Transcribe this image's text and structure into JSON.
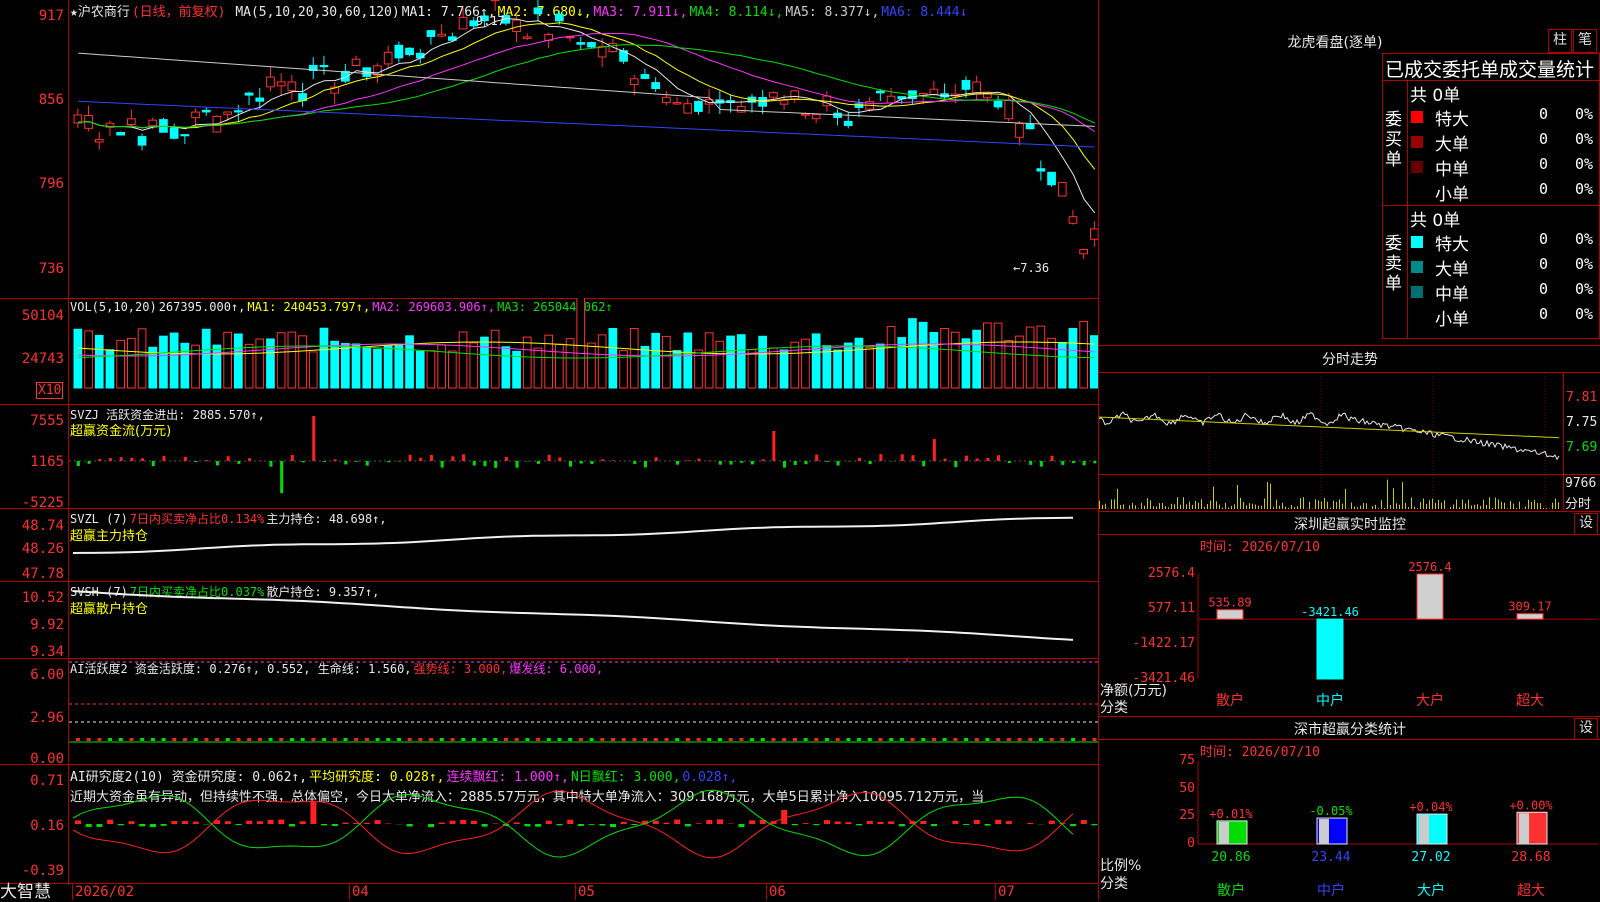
{
  "stock": {
    "title": "★沪农商行",
    "mode": "(日线，前复权)"
  },
  "main": {
    "ma_header": [
      {
        "t": "MA(5,10,20,30,60,120)",
        "c": "#e8e8e8"
      },
      {
        "t": "MA1: 7.766↑,",
        "c": "#e8e8e8"
      },
      {
        "t": "MA2: 7.680↓,",
        "c": "#ffff00"
      },
      {
        "t": "MA3: 7.911↓,",
        "c": "#ff33ff"
      },
      {
        "t": "MA4: 8.114↓,",
        "c": "#00e000"
      },
      {
        "t": "MA5: 8.377↓,",
        "c": "#cccccc"
      },
      {
        "t": "MA6: 8.444↓",
        "c": "#3344ff"
      }
    ],
    "yticks": [
      "917",
      "856",
      "796",
      "736"
    ],
    "high_label": "9.17",
    "low_label": "←7.36"
  },
  "vol": {
    "header": [
      {
        "t": "VOL(5,10,20)",
        "c": "#e8e8e8"
      },
      {
        "t": "267395.000↑,",
        "c": "#e8e8e8"
      },
      {
        "t": "MA1: 240453.797↑,",
        "c": "#ffff00"
      },
      {
        "t": "MA2: 269603.906↑,",
        "c": "#ff33ff"
      },
      {
        "t": "MA3: 265044.062↑",
        "c": "#00e000"
      }
    ],
    "yticks": [
      "50104",
      "24743"
    ],
    "unit": "X10"
  },
  "svzj": {
    "header": [
      {
        "t": "SVZJ  活跃资金进出: 2885.570↑,",
        "c": "#e8e8e8"
      }
    ],
    "sub": "超赢资金流(万元)",
    "yticks": [
      "7555",
      "1165",
      "-5225"
    ]
  },
  "svzl": {
    "header": [
      {
        "t": "SVZL (7)",
        "c": "#e8e8e8"
      },
      {
        "t": "7日内买卖净占比0.134%",
        "c": "#ff3030"
      },
      {
        "t": "主力持仓: 48.698↑,",
        "c": "#e8e8e8"
      }
    ],
    "sub": "超赢主力持仓",
    "yticks": [
      "48.74",
      "48.26",
      "47.78"
    ]
  },
  "svsh": {
    "header": [
      {
        "t": "SVSH (7)",
        "c": "#e8e8e8"
      },
      {
        "t": "7日内买卖净占比0.037%",
        "c": "#00e000"
      },
      {
        "t": "散户持仓: 9.357↑,",
        "c": "#e8e8e8"
      }
    ],
    "sub": "超赢散户持仓",
    "yticks": [
      "10.52",
      "9.92",
      "9.34"
    ]
  },
  "ai1": {
    "header": [
      {
        "t": "AI活跃度2 资金活跃度: 0.276↑, 0.552, 生命线: 1.560,",
        "c": "#e8e8e8"
      },
      {
        "t": "强势线: 3.000,",
        "c": "#ff3030"
      },
      {
        "t": "爆发线: 6.000,",
        "c": "#ff33ff"
      }
    ],
    "yticks": [
      "6.00",
      "2.96",
      "0.00"
    ]
  },
  "ai2": {
    "header": [
      {
        "t": "AI研究度2(10) 资金研究度: 0.062↑,",
        "c": "#e8e8e8"
      },
      {
        "t": "平均研究度: 0.028↑,",
        "c": "#ffff00"
      },
      {
        "t": "连续飘红: 1.000↑,",
        "c": "#ff33ff"
      },
      {
        "t": "N日飘红: 3.000,",
        "c": "#00e000"
      },
      {
        "t": "0.028↑,",
        "c": "#3344ff"
      }
    ],
    "comment": "近期大资金虽有异动，但持续性不强，总体偏空，今日大单净流入：2885.57万元，其中特大单净流入：309.168万元，大单5日累计净入10095.712万元，当",
    "yticks": [
      "0.71",
      "0.16",
      "-0.39"
    ]
  },
  "xaxis": {
    "labels": [
      "2026/02",
      "04",
      "05",
      "06",
      "07"
    ]
  },
  "brand": "大智慧",
  "right": {
    "lhkp": {
      "title": "龙虎看盘(逐单)",
      "btn1": "柱",
      "btn2": "笔"
    },
    "stats": {
      "header": "已成交委托单成交量统计",
      "buy": {
        "label": "委买单",
        "total": "共 0单",
        "rows": [
          {
            "name": "特大",
            "v": "0",
            "p": "0%",
            "color": "#ff0000"
          },
          {
            "name": "大单",
            "v": "0",
            "p": "0%",
            "color": "#990000"
          },
          {
            "name": "中单",
            "v": "0",
            "p": "0%",
            "color": "#660000"
          },
          {
            "name": "小单",
            "v": "0",
            "p": "0%",
            "color": "#000000"
          }
        ]
      },
      "sell": {
        "label": "委卖单",
        "total": "共 0单",
        "rows": [
          {
            "name": "特大",
            "v": "0",
            "p": "0%",
            "color": "#00ffff"
          },
          {
            "name": "大单",
            "v": "0",
            "p": "0%",
            "color": "#008b8b"
          },
          {
            "name": "中单",
            "v": "0",
            "p": "0%",
            "color": "#006f6f"
          },
          {
            "name": "小单",
            "v": "0",
            "p": "0%",
            "color": "#000000"
          }
        ]
      }
    },
    "fenshi": {
      "title": "分时走势",
      "yticks": [
        "7.81",
        "7.75",
        "7.69"
      ],
      "vol": "9766",
      "unit": "分时"
    },
    "szjk": {
      "title": "深圳超赢实时监控",
      "set": "设",
      "time": "时间: 2026/07/10",
      "yticks": [
        "2576.4",
        "577.11",
        "-1422.17",
        "-3421.46"
      ],
      "ylabel": "净额(万元)",
      "xlabel": "分类",
      "cats": [
        "散户",
        "中户",
        "大户",
        "超大"
      ],
      "values": [
        "535.89",
        "-3421.46",
        "2576.4",
        "309.17"
      ]
    },
    "flfx": {
      "title": "深市超赢分类统计",
      "set": "设",
      "time": "时间: 2026/07/10",
      "yticks": [
        "75",
        "50",
        "25",
        "0"
      ],
      "ylabel": "比例%",
      "xlabel": "分类",
      "cats": [
        "散户",
        "中户",
        "大户",
        "超大"
      ],
      "vals": [
        "20.86",
        "23.44",
        "27.02",
        "28.68"
      ],
      "chg": [
        "+0.01%",
        "-0.05%",
        "+0.04%",
        "+0.00%"
      ]
    }
  },
  "chart_data": [
    {
      "type": "bar",
      "title": "深圳超赢实时监控",
      "xlabel": "分类",
      "ylabel": "净额(万元)",
      "categories": [
        "散户",
        "中户",
        "大户",
        "超大"
      ],
      "values": [
        535.89,
        -3421.46,
        2576.4,
        309.17
      ],
      "ylim": [
        -3421.46,
        2576.4
      ]
    },
    {
      "type": "bar",
      "title": "深市超赢分类统计",
      "xlabel": "分类",
      "ylabel": "比例%",
      "categories": [
        "散户",
        "中户",
        "大户",
        "超大"
      ],
      "values": [
        20.86,
        23.44,
        27.02,
        28.68
      ],
      "ylim": [
        0,
        75
      ]
    }
  ]
}
